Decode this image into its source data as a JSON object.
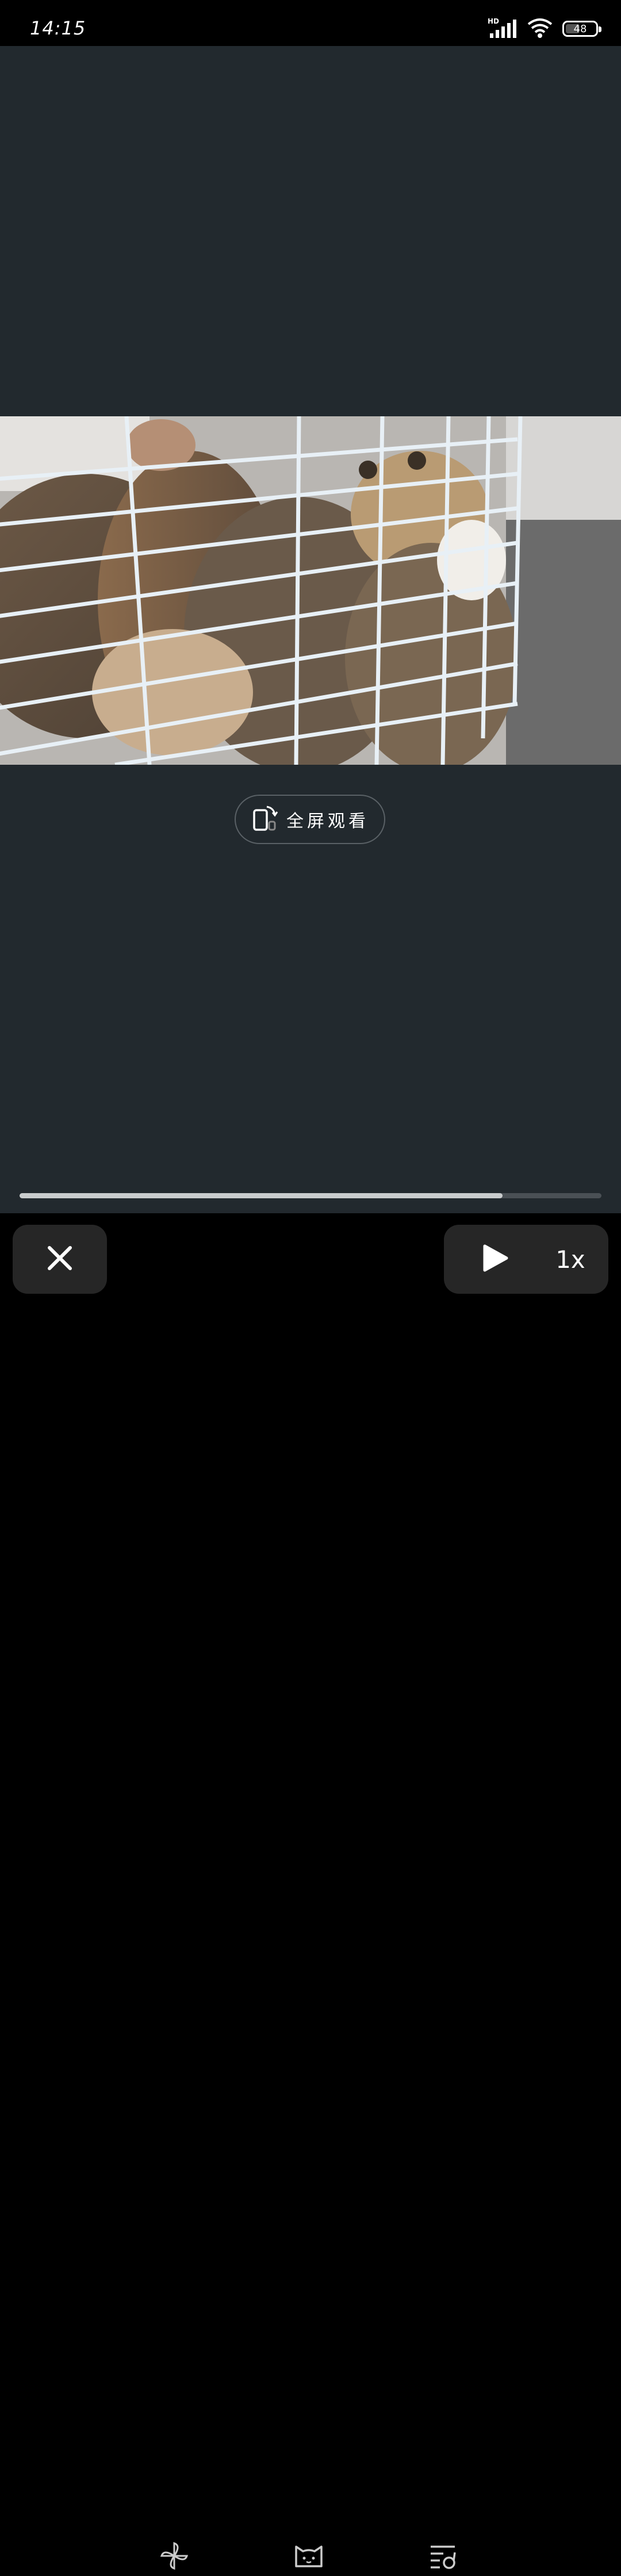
{
  "status_bar": {
    "time": "14:15",
    "network": "HD",
    "battery": "48",
    "icons": [
      "signal-icon",
      "wifi-icon",
      "battery-icon"
    ]
  },
  "player": {
    "fullscreen_label": "全屏观看",
    "progress": 0.83,
    "video_description_icon": "video-frame"
  },
  "controls": {
    "speed_label": "1x",
    "icons": [
      "close-icon",
      "play-icon"
    ]
  },
  "bottom_bar": {
    "icons": [
      "pinwheel-icon",
      "cat-face-icon",
      "playlist-icon"
    ]
  },
  "colors": {
    "player_bg": "#22292e",
    "control_bg": "#262626",
    "progress_fill": "#c9cccd",
    "progress_track": "#4a5055"
  }
}
